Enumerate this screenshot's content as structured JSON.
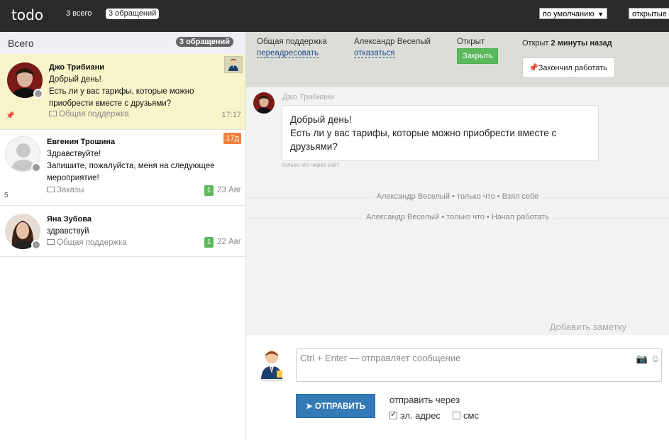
{
  "topbar": {
    "logo": "todo",
    "total_count": "3 всего",
    "requests_badge": "3 обращений",
    "sort_select": "по умолчанию",
    "status_select": "открытые"
  },
  "sidebar": {
    "title": "Всего",
    "badge": "3 обращений",
    "conversations": [
      {
        "name": "Джо Трибиани",
        "lines": [
          "Добрый день!",
          "Есть ли у вас тарифы, которые можно",
          "приобрести вместе с друзьями?"
        ],
        "channel": "Общая поддержка",
        "time": "17:17"
      },
      {
        "name": "Евгения Трошина",
        "lines": [
          "Здравствуйте!",
          "Запишите, пожалуйста, меня на следующее",
          "мероприятие!"
        ],
        "channel": "Заказы",
        "age_badge": "17д",
        "count": "1",
        "date": "23 Авг",
        "side_num": "5"
      },
      {
        "name": "Яна Зубова",
        "lines": [
          "здравствуй"
        ],
        "channel": "Общая поддержка",
        "count": "1",
        "date": "22 Авг"
      }
    ]
  },
  "info_bar": {
    "channel_label": "Общая поддержка",
    "channel_link": "переадресовать",
    "agent_label": "Александр Веселый",
    "agent_link": "отказаться",
    "status_label": "Открыт",
    "close_button": "Закрыть",
    "opened_prefix": "Открыт",
    "opened_time": "2 минуты назад",
    "finish_button": "Закончил работать"
  },
  "chat": {
    "author": "Джо Трибиани",
    "lines": [
      "Добрый день!",
      "Есть ли у вас тарифы, которые можно приобрести вместе с",
      "друзьями?"
    ],
    "meta": "только что через сайт",
    "events": [
      "Александр Веселый • только что • Взял себе",
      "Александр Веселый • только что • Начал работать"
    ],
    "add_note": "Добавить заметку"
  },
  "composer": {
    "placeholder": "Ctrl + Enter — отправляет сообщение",
    "send_button": "ОТПРАВИТЬ",
    "send_via": "отправить через",
    "option_email": "эл. адрес",
    "option_sms": "смс"
  },
  "colors": {
    "topbar": "#2b2b2b",
    "active_row": "#f7f4c9",
    "info_bar": "#ddddd7",
    "close_green": "#5cb85c",
    "send_blue": "#337ab7",
    "age_orange": "#f0803c"
  }
}
